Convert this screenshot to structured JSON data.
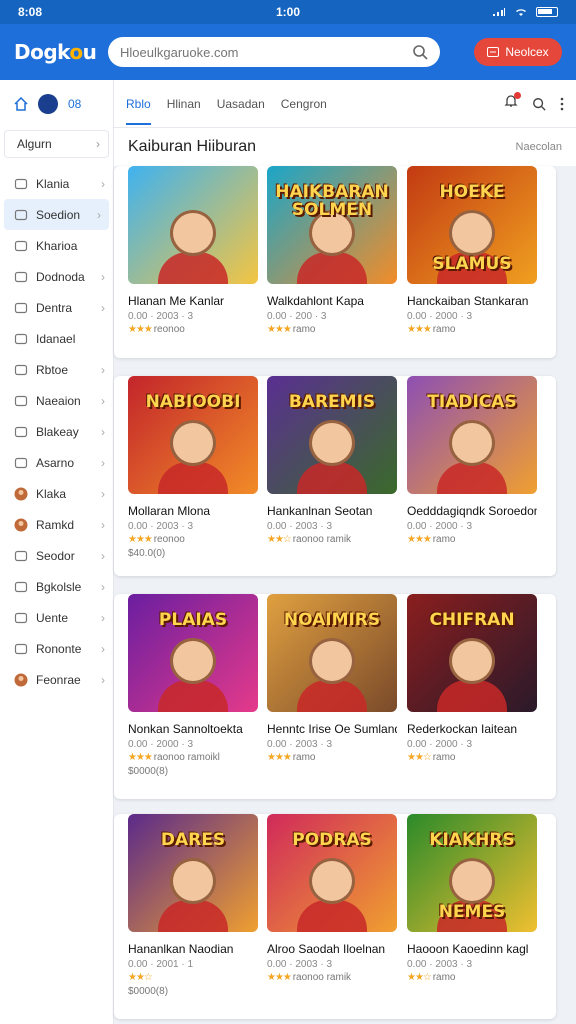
{
  "status": {
    "time_left": "8:08",
    "time_center": "1:00"
  },
  "header": {
    "logo": "Dogkou",
    "search_placeholder": "Hloeulkgaruoke.com",
    "button_label": "Neolcex"
  },
  "sidebar": {
    "top_label": "08",
    "category": "Algurn",
    "items": [
      {
        "label": "Klania",
        "icon": "users-icon",
        "chev": true
      },
      {
        "label": "Soedion",
        "icon": "gamepad-icon",
        "chev": true,
        "active": true
      },
      {
        "label": "Kharioa",
        "icon": "home-icon",
        "chev": false
      },
      {
        "label": "Dodnoda",
        "icon": "user-icon",
        "chev": true
      },
      {
        "label": "Dentra",
        "icon": "doc-icon",
        "chev": true
      },
      {
        "label": "Idanael",
        "icon": "doc-icon",
        "chev": false
      },
      {
        "label": "Rbtoe",
        "icon": "puzzle-icon",
        "chev": true
      },
      {
        "label": "Naeaion",
        "icon": "pen-icon",
        "chev": true
      },
      {
        "label": "Blakeay",
        "icon": "image-icon",
        "chev": true
      },
      {
        "label": "Asarno",
        "icon": "ticket-icon",
        "chev": true
      },
      {
        "label": "Klaka",
        "icon": "avatar-icon",
        "chev": true
      },
      {
        "label": "Ramkd",
        "icon": "avatar-icon",
        "chev": true
      },
      {
        "label": "Seodor",
        "icon": "tree-icon",
        "chev": true
      },
      {
        "label": "Bgkolsle",
        "icon": "calendar-icon",
        "chev": true
      },
      {
        "label": "Uente",
        "icon": "card-icon",
        "chev": true
      },
      {
        "label": "Rononte",
        "icon": "card-icon",
        "chev": true
      },
      {
        "label": "Feonrae",
        "icon": "avatar-icon",
        "chev": true
      }
    ]
  },
  "tabs": [
    "Rblo",
    "Hlinan",
    "Uasadan",
    "Cengron"
  ],
  "section": {
    "title": "Kaiburan Hiiburan",
    "more": "Naecolan"
  },
  "games": [
    {
      "title": "Hlanan Me Kanlar",
      "sub": "0.00 · 2003 · 3",
      "rating": "3",
      "rating_text": "reonoo",
      "extra": "",
      "caption": "",
      "caption2": "",
      "bg": [
        "#3fb2f0",
        "#f4c542"
      ]
    },
    {
      "title": "Walkdahlont Kapa",
      "sub": "0.00 · 200 · 3",
      "rating": "3",
      "rating_text": "ramo",
      "extra": "",
      "caption": "HAIKBARAN SOLMEN",
      "caption2": "",
      "bg": [
        "#1aa6c9",
        "#f28c28"
      ]
    },
    {
      "title": "Hanckaiban Stankaran",
      "sub": "0.00 · 2000 · 3",
      "rating": "3",
      "rating_text": "ramo",
      "extra": "",
      "caption": "HOEKE",
      "caption2": "SLAMUS",
      "bg": [
        "#c23a12",
        "#f0a020"
      ]
    },
    {
      "title": "Mollaran Mlona",
      "sub": "0.00 · 2003 · 3",
      "rating": "3",
      "rating_text": "reonoo",
      "extra": "$40.0(0)",
      "caption": "NABIOOBI",
      "caption2": "",
      "bg": [
        "#c2252b",
        "#f28c28"
      ]
    },
    {
      "title": "Hankanlnan Seotan",
      "sub": "0.00 · 2003 · 3",
      "rating": "2",
      "rating_text": "raonoo ramik",
      "extra": "",
      "caption": "BAREMIS",
      "caption2": "",
      "bg": [
        "#5a2f92",
        "#3a6a2a"
      ]
    },
    {
      "title": "Oedddagiqndk Soroedon",
      "sub": "0.00 · 2000 · 3",
      "rating": "3",
      "rating_text": "ramo",
      "extra": "",
      "caption": "TIADICAS",
      "caption2": "",
      "bg": [
        "#8d4fb3",
        "#f0a030"
      ]
    },
    {
      "title": "Nonkan Sannoltoekta",
      "sub": "0.00 · 2000 · 3",
      "rating": "3",
      "rating_text": "raonoo ramoikl",
      "extra": "$0000(8)",
      "caption": "PLAIAS",
      "caption2": "",
      "bg": [
        "#6a1ea0",
        "#e53a8a"
      ]
    },
    {
      "title": "Henntc Irise Oe Sumland",
      "sub": "0.00 · 2003 · 3",
      "rating": "3",
      "rating_text": "ramo",
      "extra": "",
      "caption": "NOAIMIRS",
      "caption2": "",
      "bg": [
        "#e0a040",
        "#7a4a2a"
      ]
    },
    {
      "title": "Rederkockan Iaitean",
      "sub": "0.00 · 2000 · 3",
      "rating": "2",
      "rating_text": "ramo",
      "extra": "",
      "caption": "CHIFRAN",
      "caption2": "",
      "bg": [
        "#8a1e1e",
        "#2a1a2a"
      ]
    },
    {
      "title": "Hananlkan Naodian",
      "sub": "0.00 · 2001 · 1",
      "rating": "2",
      "rating_text": "",
      "extra": "$0000(8)",
      "caption": "DARES",
      "caption2": "",
      "bg": [
        "#5a2a8a",
        "#f0a030"
      ]
    },
    {
      "title": "Alroo Saodah Iloelnan",
      "sub": "0.00 · 2003 · 3",
      "rating": "3",
      "rating_text": "raonoo ramik",
      "extra": "",
      "caption": "PODRAS",
      "caption2": "",
      "bg": [
        "#d02a5a",
        "#f0a030"
      ]
    },
    {
      "title": "Haooon Kaoedinn kagl",
      "sub": "0.00 · 2003 · 3",
      "rating": "2",
      "rating_text": "ramo",
      "extra": "",
      "caption": "KIAKHRS",
      "caption2": "NEMES",
      "bg": [
        "#2a8a2a",
        "#f0c030"
      ]
    }
  ]
}
